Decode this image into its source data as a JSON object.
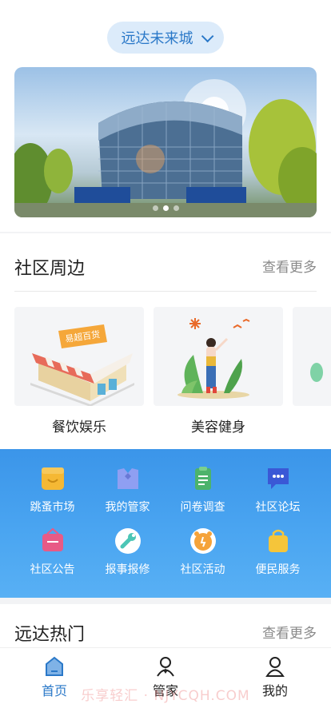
{
  "header": {
    "location": "远达未来城"
  },
  "banner": {
    "slides": 3,
    "active_slide": 1
  },
  "community": {
    "title": "社区周边",
    "more_label": "查看更多",
    "cards": [
      {
        "label": "餐饮娱乐",
        "image_text": "易超百货"
      },
      {
        "label": "美容健身"
      }
    ]
  },
  "services": {
    "items": [
      {
        "label": "跳蚤市场",
        "icon": "shop-icon",
        "color": "#f5b834"
      },
      {
        "label": "我的管家",
        "icon": "butler-icon",
        "color": "#8f9ff2"
      },
      {
        "label": "问卷调查",
        "icon": "survey-icon",
        "color": "#4cb36b"
      },
      {
        "label": "社区论坛",
        "icon": "forum-icon",
        "color": "#3a58d6"
      },
      {
        "label": "社区公告",
        "icon": "notice-icon",
        "color": "#e85a86"
      },
      {
        "label": "报事报修",
        "icon": "wrench-icon",
        "color": "#4cc6b6"
      },
      {
        "label": "社区活动",
        "icon": "clock-icon",
        "color": "#f5a33a"
      },
      {
        "label": "便民服务",
        "icon": "bag-icon",
        "color": "#f5c53a"
      }
    ]
  },
  "hot": {
    "title": "远达热门",
    "more_label": "查看更多"
  },
  "tabbar": {
    "items": [
      {
        "label": "首页",
        "icon": "home-icon",
        "active": true
      },
      {
        "label": "管家",
        "icon": "butler-person-icon",
        "active": false
      },
      {
        "label": "我的",
        "icon": "profile-icon",
        "active": false
      }
    ]
  },
  "watermark": "乐享轻汇 · NJYCQH.COM",
  "colors": {
    "accent": "#2a78c8",
    "service_bg": "#3b95e9"
  }
}
